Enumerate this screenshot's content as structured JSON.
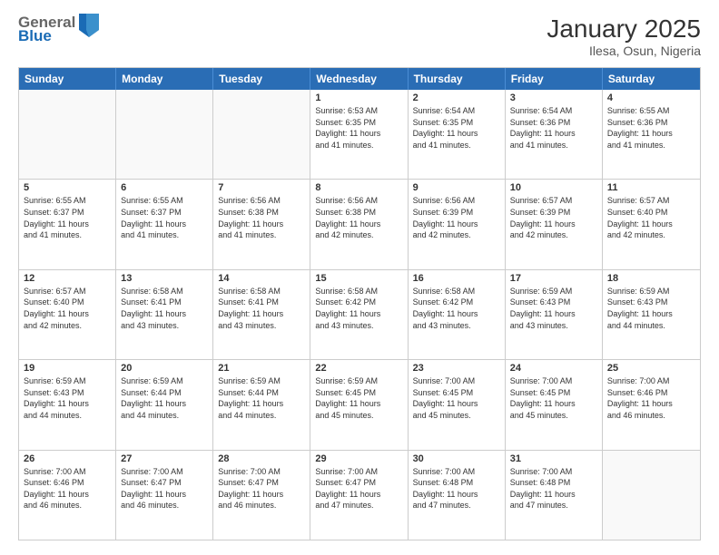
{
  "header": {
    "logo_line1": "General",
    "logo_line2": "Blue",
    "month_year": "January 2025",
    "location": "Ilesa, Osun, Nigeria"
  },
  "weekdays": [
    "Sunday",
    "Monday",
    "Tuesday",
    "Wednesday",
    "Thursday",
    "Friday",
    "Saturday"
  ],
  "weeks": [
    [
      {
        "day": "",
        "info": ""
      },
      {
        "day": "",
        "info": ""
      },
      {
        "day": "",
        "info": ""
      },
      {
        "day": "1",
        "info": "Sunrise: 6:53 AM\nSunset: 6:35 PM\nDaylight: 11 hours\nand 41 minutes."
      },
      {
        "day": "2",
        "info": "Sunrise: 6:54 AM\nSunset: 6:35 PM\nDaylight: 11 hours\nand 41 minutes."
      },
      {
        "day": "3",
        "info": "Sunrise: 6:54 AM\nSunset: 6:36 PM\nDaylight: 11 hours\nand 41 minutes."
      },
      {
        "day": "4",
        "info": "Sunrise: 6:55 AM\nSunset: 6:36 PM\nDaylight: 11 hours\nand 41 minutes."
      }
    ],
    [
      {
        "day": "5",
        "info": "Sunrise: 6:55 AM\nSunset: 6:37 PM\nDaylight: 11 hours\nand 41 minutes."
      },
      {
        "day": "6",
        "info": "Sunrise: 6:55 AM\nSunset: 6:37 PM\nDaylight: 11 hours\nand 41 minutes."
      },
      {
        "day": "7",
        "info": "Sunrise: 6:56 AM\nSunset: 6:38 PM\nDaylight: 11 hours\nand 41 minutes."
      },
      {
        "day": "8",
        "info": "Sunrise: 6:56 AM\nSunset: 6:38 PM\nDaylight: 11 hours\nand 42 minutes."
      },
      {
        "day": "9",
        "info": "Sunrise: 6:56 AM\nSunset: 6:39 PM\nDaylight: 11 hours\nand 42 minutes."
      },
      {
        "day": "10",
        "info": "Sunrise: 6:57 AM\nSunset: 6:39 PM\nDaylight: 11 hours\nand 42 minutes."
      },
      {
        "day": "11",
        "info": "Sunrise: 6:57 AM\nSunset: 6:40 PM\nDaylight: 11 hours\nand 42 minutes."
      }
    ],
    [
      {
        "day": "12",
        "info": "Sunrise: 6:57 AM\nSunset: 6:40 PM\nDaylight: 11 hours\nand 42 minutes."
      },
      {
        "day": "13",
        "info": "Sunrise: 6:58 AM\nSunset: 6:41 PM\nDaylight: 11 hours\nand 43 minutes."
      },
      {
        "day": "14",
        "info": "Sunrise: 6:58 AM\nSunset: 6:41 PM\nDaylight: 11 hours\nand 43 minutes."
      },
      {
        "day": "15",
        "info": "Sunrise: 6:58 AM\nSunset: 6:42 PM\nDaylight: 11 hours\nand 43 minutes."
      },
      {
        "day": "16",
        "info": "Sunrise: 6:58 AM\nSunset: 6:42 PM\nDaylight: 11 hours\nand 43 minutes."
      },
      {
        "day": "17",
        "info": "Sunrise: 6:59 AM\nSunset: 6:43 PM\nDaylight: 11 hours\nand 43 minutes."
      },
      {
        "day": "18",
        "info": "Sunrise: 6:59 AM\nSunset: 6:43 PM\nDaylight: 11 hours\nand 44 minutes."
      }
    ],
    [
      {
        "day": "19",
        "info": "Sunrise: 6:59 AM\nSunset: 6:43 PM\nDaylight: 11 hours\nand 44 minutes."
      },
      {
        "day": "20",
        "info": "Sunrise: 6:59 AM\nSunset: 6:44 PM\nDaylight: 11 hours\nand 44 minutes."
      },
      {
        "day": "21",
        "info": "Sunrise: 6:59 AM\nSunset: 6:44 PM\nDaylight: 11 hours\nand 44 minutes."
      },
      {
        "day": "22",
        "info": "Sunrise: 6:59 AM\nSunset: 6:45 PM\nDaylight: 11 hours\nand 45 minutes."
      },
      {
        "day": "23",
        "info": "Sunrise: 7:00 AM\nSunset: 6:45 PM\nDaylight: 11 hours\nand 45 minutes."
      },
      {
        "day": "24",
        "info": "Sunrise: 7:00 AM\nSunset: 6:45 PM\nDaylight: 11 hours\nand 45 minutes."
      },
      {
        "day": "25",
        "info": "Sunrise: 7:00 AM\nSunset: 6:46 PM\nDaylight: 11 hours\nand 46 minutes."
      }
    ],
    [
      {
        "day": "26",
        "info": "Sunrise: 7:00 AM\nSunset: 6:46 PM\nDaylight: 11 hours\nand 46 minutes."
      },
      {
        "day": "27",
        "info": "Sunrise: 7:00 AM\nSunset: 6:47 PM\nDaylight: 11 hours\nand 46 minutes."
      },
      {
        "day": "28",
        "info": "Sunrise: 7:00 AM\nSunset: 6:47 PM\nDaylight: 11 hours\nand 46 minutes."
      },
      {
        "day": "29",
        "info": "Sunrise: 7:00 AM\nSunset: 6:47 PM\nDaylight: 11 hours\nand 47 minutes."
      },
      {
        "day": "30",
        "info": "Sunrise: 7:00 AM\nSunset: 6:48 PM\nDaylight: 11 hours\nand 47 minutes."
      },
      {
        "day": "31",
        "info": "Sunrise: 7:00 AM\nSunset: 6:48 PM\nDaylight: 11 hours\nand 47 minutes."
      },
      {
        "day": "",
        "info": ""
      }
    ]
  ]
}
